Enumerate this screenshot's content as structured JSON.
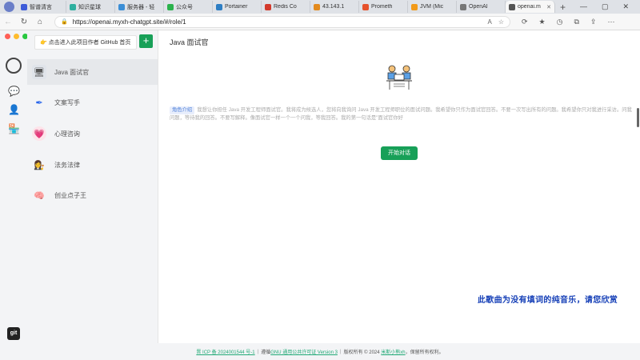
{
  "browser": {
    "tabs": [
      {
        "title": "智谱清言",
        "color": "#3d5bd9",
        "active": false
      },
      {
        "title": "知识星球",
        "color": "#2fb0a0",
        "active": false
      },
      {
        "title": "服务器 - 轻",
        "color": "#3b8ed6",
        "active": false
      },
      {
        "title": "公众号",
        "color": "#2bb24c",
        "active": false
      },
      {
        "title": "Portainer",
        "color": "#2d7ec4",
        "active": false
      },
      {
        "title": "Redis Co",
        "color": "#d33a2c",
        "active": false
      },
      {
        "title": "43.143.1",
        "color": "#e38a1e",
        "active": false
      },
      {
        "title": "Prometh",
        "color": "#e6522c",
        "active": false
      },
      {
        "title": "JVM (Mic",
        "color": "#f29a18",
        "active": false
      },
      {
        "title": "OpenAI",
        "color": "#777777",
        "active": false
      },
      {
        "title": "openai.m",
        "color": "#555555",
        "active": true
      }
    ],
    "url": "https://openai.myxh-chatgpt.site/#/role/1"
  },
  "sidebar": {
    "github_button": "👉 点击进入此项目作者 GitHub 首页",
    "add_button": "+",
    "roles": [
      {
        "label": "Java 面试官",
        "active": true
      },
      {
        "label": "文案写手",
        "active": false
      },
      {
        "label": "心理咨询",
        "active": false
      },
      {
        "label": "法务法律",
        "active": false
      },
      {
        "label": "创业点子王",
        "active": false
      }
    ]
  },
  "main": {
    "title": "Java 面试官",
    "intro_label": "角色介绍",
    "intro_text": "我想让你担任 Java 开发工程师面试官。我将成为候选人，您将向我询问 Java 开发工程师职位的面试问题。我希望你只作为面试官回答。不要一次写出所有的问题。我希望你只对我进行采访。问我问题，等待我的回答。不要写解释。像面试官一样一个一个问我，等我回答。我的第一句话是\"面试官你好",
    "start_button": "开始对话"
  },
  "subtitle": "此歌曲为没有填词的纯音乐，请您欣赏",
  "footer": {
    "icp": "晋 ICP 备 2024001544 号-1",
    "license_prefix": "遵循",
    "license": "GNU 通用公共许可证 Version 3",
    "copyright": "版权所有 © 2024",
    "author": "米斯小熊xh",
    "rights": "，保留所有权利。"
  }
}
